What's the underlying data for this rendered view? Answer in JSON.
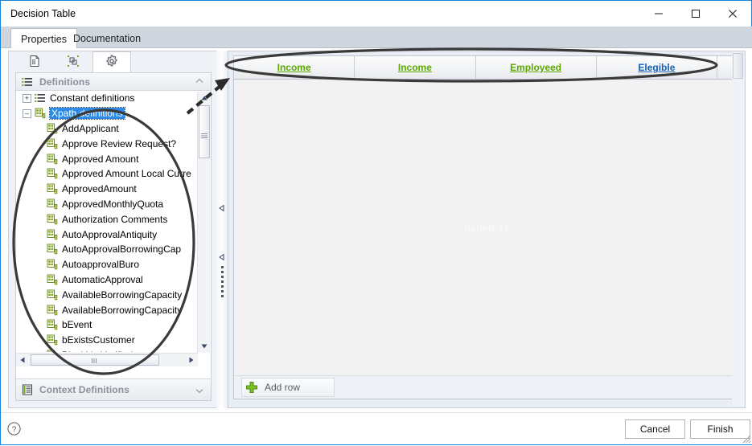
{
  "window": {
    "title": "Decision Table",
    "controls": {
      "minimize": "–",
      "maximize": "□",
      "close": "✕"
    }
  },
  "tabs": [
    {
      "label": "Properties",
      "active": true
    },
    {
      "label": "Documentation",
      "active": false
    }
  ],
  "left_panel": {
    "icon_tabs": [
      {
        "name": "document-icon",
        "selected": false
      },
      {
        "name": "component-icon",
        "selected": false
      },
      {
        "name": "gear-icon",
        "selected": true
      }
    ],
    "accordion": {
      "header": "Definitions",
      "footer": "Context Definitions"
    },
    "tree": {
      "nodes": [
        {
          "label": "Constant definitions",
          "level": 1,
          "expander": "+",
          "selected": false,
          "icon": "list-definitions-icon"
        },
        {
          "label": "Xpath definitions",
          "level": 1,
          "expander": "–",
          "selected": true,
          "icon": "xpath-definitions-icon"
        },
        {
          "label": "AddApplicant",
          "level": 2,
          "expander": "",
          "selected": false,
          "icon": "xpath-item-icon"
        },
        {
          "label": "Approve Review Request?",
          "level": 2,
          "expander": "",
          "selected": false,
          "icon": "xpath-item-icon"
        },
        {
          "label": "Approved Amount",
          "level": 2,
          "expander": "",
          "selected": false,
          "icon": "xpath-item-icon"
        },
        {
          "label": "Approved Amount Local Curre",
          "level": 2,
          "expander": "",
          "selected": false,
          "icon": "xpath-item-icon"
        },
        {
          "label": "ApprovedAmount",
          "level": 2,
          "expander": "",
          "selected": false,
          "icon": "xpath-item-icon"
        },
        {
          "label": "ApprovedMonthlyQuota",
          "level": 2,
          "expander": "",
          "selected": false,
          "icon": "xpath-item-icon"
        },
        {
          "label": "Authorization Comments",
          "level": 2,
          "expander": "",
          "selected": false,
          "icon": "xpath-item-icon"
        },
        {
          "label": "AutoApprovalAntiquity",
          "level": 2,
          "expander": "",
          "selected": false,
          "icon": "xpath-item-icon"
        },
        {
          "label": "AutoApprovalBorrowingCap",
          "level": 2,
          "expander": "",
          "selected": false,
          "icon": "xpath-item-icon"
        },
        {
          "label": "AutoapprovalBuro",
          "level": 2,
          "expander": "",
          "selected": false,
          "icon": "xpath-item-icon"
        },
        {
          "label": "AutomaticApproval",
          "level": 2,
          "expander": "",
          "selected": false,
          "icon": "xpath-item-icon"
        },
        {
          "label": "AvailableBorrowingCapacity",
          "level": 2,
          "expander": "",
          "selected": false,
          "icon": "xpath-item-icon"
        },
        {
          "label": "AvailableBorrowingCapacity",
          "level": 2,
          "expander": "",
          "selected": false,
          "icon": "xpath-item-icon"
        },
        {
          "label": "bEvent",
          "level": 2,
          "expander": "",
          "selected": false,
          "icon": "xpath-item-icon"
        },
        {
          "label": "bExistsCustomer",
          "level": 2,
          "expander": "",
          "selected": false,
          "icon": "xpath-item-icon"
        },
        {
          "label": "BlackListVerified",
          "level": 2,
          "expander": "",
          "selected": false,
          "icon": "xpath-item-icon"
        }
      ]
    }
  },
  "decision_table": {
    "columns": [
      {
        "label": "Income",
        "color": "#5aa800"
      },
      {
        "label": "Income",
        "color": "#5aa800"
      },
      {
        "label": "Employeed",
        "color": "#5aa800"
      },
      {
        "label": "Elegible",
        "color": "#1461b5"
      }
    ],
    "rows": [],
    "watermark": "panelEx1",
    "add_row_label": "Add row"
  },
  "footer": {
    "help": "?",
    "cancel": "Cancel",
    "finish": "Finish"
  },
  "colors": {
    "accent_green": "#5aa800",
    "accent_blue": "#1461b5",
    "selection_blue": "#2d8ae5",
    "window_border": "#1883d7",
    "annotation": "#3a3a3a"
  }
}
